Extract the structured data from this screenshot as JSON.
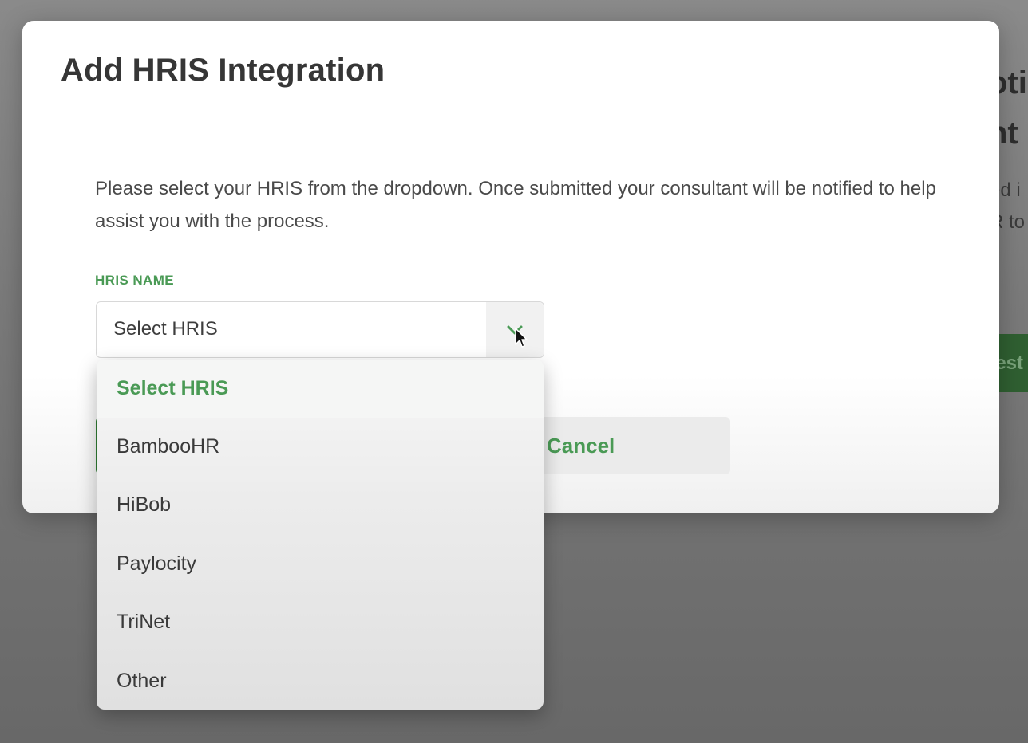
{
  "background": {
    "heading_line1": "otic",
    "heading_line2": "nt",
    "text_line1": "ed i",
    "text_line2": "R to",
    "button_label": "est"
  },
  "modal": {
    "title": "Add HRIS Integration",
    "description": "Please select your HRIS from the dropdown. Once submitted your consultant will be notified to help assist you with the process.",
    "field_label": "HRIS NAME",
    "select_value": "Select HRIS",
    "cancel_label": "Cancel"
  },
  "dropdown": {
    "options": [
      {
        "label": "Select HRIS",
        "selected": true
      },
      {
        "label": "BambooHR",
        "selected": false
      },
      {
        "label": "HiBob",
        "selected": false
      },
      {
        "label": "Paylocity",
        "selected": false
      },
      {
        "label": "TriNet",
        "selected": false
      },
      {
        "label": "Other",
        "selected": false
      }
    ]
  },
  "colors": {
    "accent_green": "#4a9a55",
    "primary_button_green": "#2e7d32",
    "overlay_gray": "#6b6b6b"
  },
  "icons": {
    "select_arrow": "chevron-down-icon",
    "cursor": "mouse-cursor-icon"
  }
}
